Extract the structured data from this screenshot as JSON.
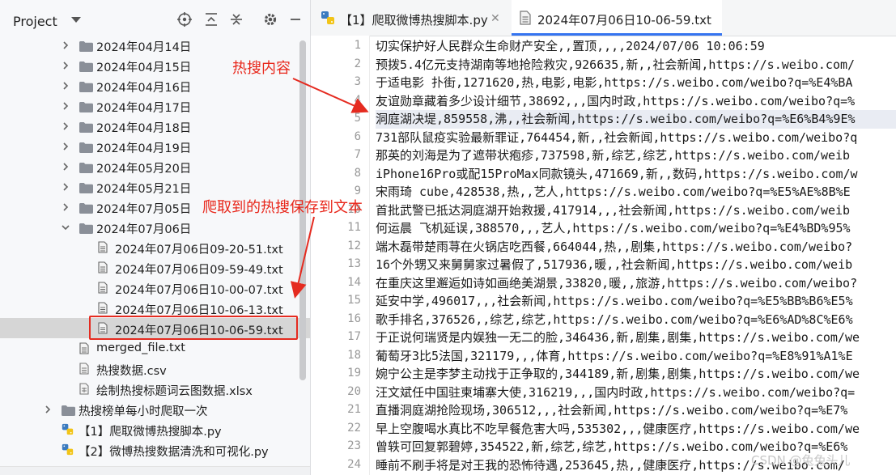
{
  "project_panel": {
    "title": "Project",
    "tools": [
      "target-icon",
      "expand-all-icon",
      "collapse-all-icon",
      "gear-icon",
      "minimize-icon"
    ],
    "items": [
      {
        "label": "2024年04月14日",
        "kind": "folder",
        "expanded": false
      },
      {
        "label": "2024年04月15日",
        "kind": "folder",
        "expanded": false
      },
      {
        "label": "2024年04月16日",
        "kind": "folder",
        "expanded": false
      },
      {
        "label": "2024年04月17日",
        "kind": "folder",
        "expanded": false
      },
      {
        "label": "2024年04月18日",
        "kind": "folder",
        "expanded": false
      },
      {
        "label": "2024年04月19日",
        "kind": "folder",
        "expanded": false
      },
      {
        "label": "2024年05月20日",
        "kind": "folder",
        "expanded": false
      },
      {
        "label": "2024年05月21日",
        "kind": "folder",
        "expanded": false
      },
      {
        "label": "2024年07月05日",
        "kind": "folder",
        "expanded": false
      },
      {
        "label": "2024年07月06日",
        "kind": "folder",
        "expanded": true
      },
      {
        "label": "2024年07月06日09-20-51.txt",
        "kind": "txt"
      },
      {
        "label": "2024年07月06日09-59-49.txt",
        "kind": "txt"
      },
      {
        "label": "2024年07月06日10-00-07.txt",
        "kind": "txt"
      },
      {
        "label": "2024年07月06日10-06-13.txt",
        "kind": "txt"
      },
      {
        "label": "2024年07月06日10-06-59.txt",
        "kind": "txt",
        "selected": true
      },
      {
        "label": "merged_file.txt",
        "kind": "txt"
      },
      {
        "label": "热搜数据.csv",
        "kind": "csv"
      },
      {
        "label": "绘制热搜标题词云图数据.xlsx",
        "kind": "xlsx"
      },
      {
        "label": "热搜榜单每小时爬取一次",
        "kind": "folder",
        "expanded": false
      },
      {
        "label": "【1】爬取微博热搜脚本.py",
        "kind": "py"
      },
      {
        "label": "【2】微博热搜数据清洗和可视化.py",
        "kind": "py"
      }
    ]
  },
  "editor": {
    "tabs": [
      {
        "label": "【1】爬取微博热搜脚本.py",
        "icon": "python-icon",
        "active": false
      },
      {
        "label": "2024年07月06日10-06-59.txt",
        "icon": "text-file-icon",
        "active": true
      }
    ],
    "highlight_line": 5,
    "lines": [
      "切实保护好人民群众生命财产安全,,置顶,,,,2024/07/06 10:06:59",
      "预拨5.4亿元支持湖南等地抢险救灾,926635,新,,社会新闻,https://s.weibo.com/",
      "于适电影 扑街,1271620,热,电影,电影,https://s.weibo.com/weibo?q=%E4%BA",
      "友谊勋章藏着多少设计细节,38692,,,国内时政,https://s.weibo.com/weibo?q=%",
      "洞庭湖决堤,859558,沸,,社会新闻,https://s.weibo.com/weibo?q=%E6%B4%9E%",
      "731部队鼠疫实验最新罪证,764454,新,,社会新闻,https://s.weibo.com/weibo?q",
      "那英的刘海是为了遮带状疱疹,737598,新,综艺,综艺,https://s.weibo.com/weib",
      "iPhone16Pro或配15ProMax同款镜头,471669,新,,数码,https://s.weibo.com/w",
      "宋雨琦 cube,428538,热,,艺人,https://s.weibo.com/weibo?q=%E5%AE%8B%E",
      "首批武警已抵达洞庭湖开始救援,417914,,,社会新闻,https://s.weibo.com/weib",
      "何运晨 飞机延误,388570,,,艺人,https://s.weibo.com/weibo?q=%E4%BD%95%",
      "端木磊带楚雨荨在火锅店吃西餐,664044,热,,剧集,https://s.weibo.com/weibo?",
      "16个外甥又来舅舅家过暑假了,517936,暖,,社会新闻,https://s.weibo.com/weib",
      "在重庆这里邂逅如诗如画绝美湖景,33820,暖,,旅游,https://s.weibo.com/weibo?",
      "延安中学,496017,,,社会新闻,https://s.weibo.com/weibo?q=%E5%BB%B6%E5%",
      "歌手排名,376526,,综艺,综艺,https://s.weibo.com/weibo?q=%E6%AD%8C%E6%",
      "于正说何瑞贤是内娱独一无二的脸,346436,新,剧集,剧集,https://s.weibo.com/we",
      "葡萄牙3比5法国,321179,,,体育,https://s.weibo.com/weibo?q=%E8%91%A1%E",
      "婉宁公主是李梦主动找于正争取的,344189,新,剧集,剧集,https://s.weibo.com/we",
      "汪文斌任中国驻柬埔寨大使,316219,,,国内时政,https://s.weibo.com/weibo?q=",
      "直播洞庭湖抢险现场,306512,,,社会新闻,https://s.weibo.com/weibo?q=%E7%",
      "早上空腹喝水真比不吃早餐危害大吗,535302,,,健康医疗,https://s.weibo.com/we",
      "曾轶可回复郭碧婷,354522,新,综艺,综艺,https://s.weibo.com/weibo?q=%E6%",
      "睡前不刷手将是对王我的恐怖待遇,253645,热,,健康医疗,https://s.weibo.com/"
    ]
  },
  "annotations": {
    "hot_search_content": "热搜内容",
    "saved_to_text": "爬取到的热搜保存到文本"
  },
  "watermark": "CSDN @兔兔头儿",
  "colors": {
    "annotation_red": "#e52b20",
    "accent_blue": "#3574f0"
  }
}
